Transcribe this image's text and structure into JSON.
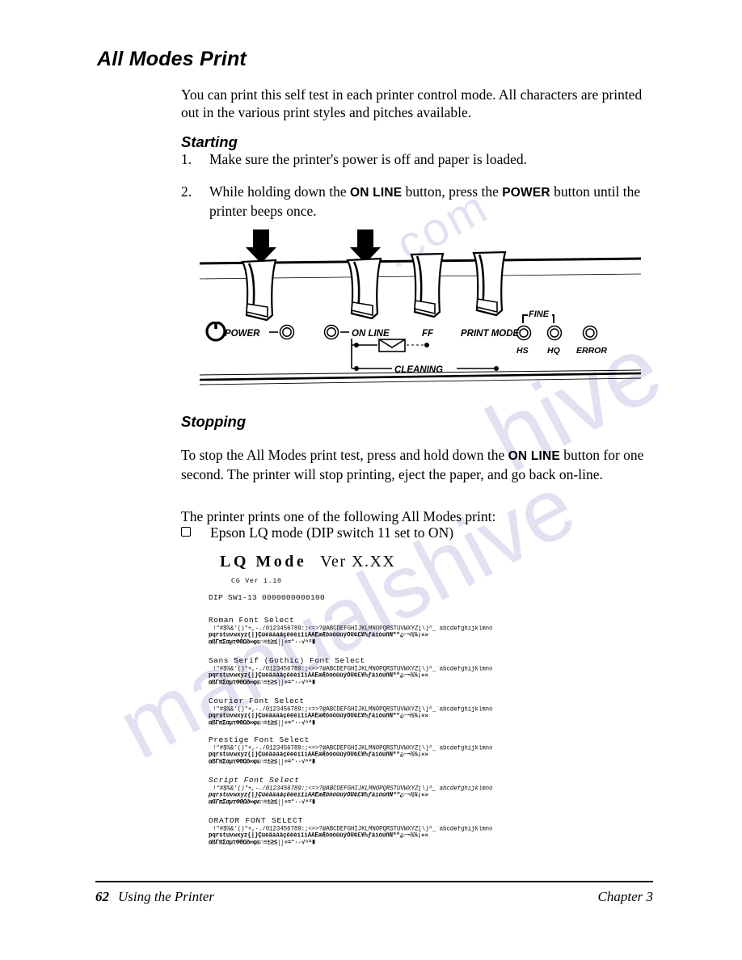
{
  "page": {
    "title": "All Modes Print",
    "intro": "You can print this self test in each printer control mode. All characters are printed out in the various print styles and pitches available."
  },
  "starting": {
    "heading": "Starting",
    "steps": [
      {
        "number": "1.",
        "text_before": "Make sure the printer's power is off and paper is loaded.",
        "bold_1": "",
        "text_mid": "",
        "bold_2": "",
        "text_after": ""
      },
      {
        "number": "2.",
        "text_before": "While holding down the ",
        "bold_1": "ON LINE",
        "text_mid": " button, press the ",
        "bold_2": "POWER",
        "text_after": " button until the printer beeps once."
      }
    ]
  },
  "panel": {
    "power_label": "POWER",
    "online_label": "ON LINE",
    "ff_label": "FF",
    "print_mode_label": "PRINT MODE",
    "fine_label": "FINE",
    "hs_label": "HS",
    "hq_label": "HQ",
    "error_label": "ERROR",
    "cleaning_label": "CLEANING"
  },
  "stopping": {
    "heading": "Stopping",
    "text_before": "To stop the All Modes print test, press and hold down the ",
    "bold_1": "ON LINE",
    "text_after": " button for one second. The printer will stop printing, eject the paper, and go back on-line.",
    "prints_one": "The printer prints one of the following All Modes print:",
    "bullet_item": "Epson LQ mode (DIP switch 11 set to ON)"
  },
  "printout": {
    "mode_title": "LQ Mode",
    "ver_label": "Ver X.XX",
    "cg_ver": "CG Ver 1.10",
    "dip_sw": "DIP SW1-13 0000000000100",
    "char_line_1": "!\"#$%&'()*+,-./0123456789:;<=>?@ABCDEFGHIJKLMNOPQRSTUVWXYZ[\\]^_`abcdefghijklmno",
    "char_line_2": "pqrstuvwxyz{|}ÇüéâäàåçêëèïîìÄÅÉæÆôöòûùÿÖÜ¢£¥₧ƒáíóúñÑªº¿⌐¬½¼¡«»",
    "char_line_3": "αßΓπΣσµτΦΘΩδ∞φε∩≡±≥≤⌠⌡÷≈°∙·√ⁿ²∎",
    "font_blocks": [
      {
        "label": "Roman Font Select",
        "style": "normal"
      },
      {
        "label": "Sans Serif (Gothic) Font Select",
        "style": "normal"
      },
      {
        "label": "Courier Font Select",
        "style": "normal"
      },
      {
        "label": "Prestige Font Select",
        "style": "normal"
      },
      {
        "label": "Script Font Select",
        "style": "italic"
      },
      {
        "label": "ORATOR FONT SELECT",
        "style": "caps"
      }
    ]
  },
  "footer": {
    "page_number": "62",
    "section": "Using the Printer",
    "chapter": "Chapter 3"
  },
  "watermark": {
    "line_a": "hive",
    "line_b": "manualshive",
    "line_c": ".com"
  }
}
